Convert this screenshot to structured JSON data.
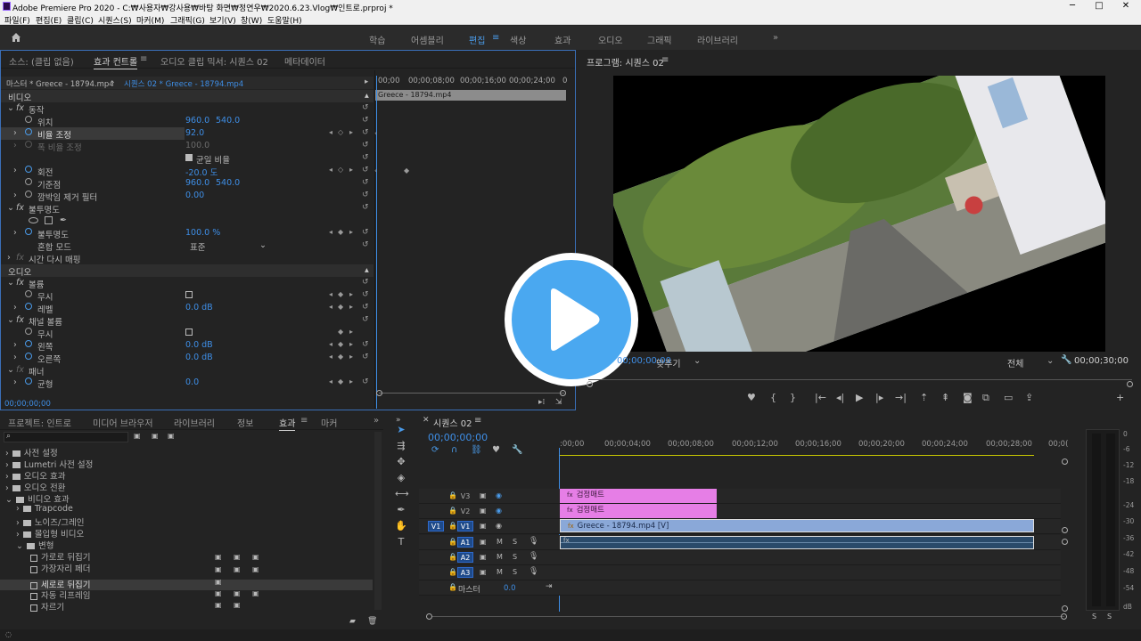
{
  "titlebar": {
    "title": "Adobe Premiere Pro 2020 - C:₩사용자₩강사용₩바탕 화면₩정연우₩2020.6.23.Vlog₩인트로.prproj *",
    "min": "─",
    "max": "□",
    "close": "✕"
  },
  "menu": [
    "파일(F)",
    "편집(E)",
    "클립(C)",
    "시퀀스(S)",
    "마커(M)",
    "그래픽(G)",
    "보기(V)",
    "창(W)",
    "도움말(H)"
  ],
  "workspaces": [
    {
      "label": "학습"
    },
    {
      "label": "어셈블리"
    },
    {
      "label": "편집",
      "active": true
    },
    {
      "label": "색상"
    },
    {
      "label": "효과"
    },
    {
      "label": "오디오"
    },
    {
      "label": "그래픽"
    },
    {
      "label": "라이브러리"
    }
  ],
  "workspaces_more": "»",
  "effect_controls": {
    "tabs": [
      "소스: (클립 없음)",
      "효과 컨트롤",
      "오디오 클립 믹서: 시퀀스 02",
      "메타데이터"
    ],
    "master": "마스터 * Greece - 18794.mp4",
    "sequence": "시퀀스 02 * Greece - 18794.mp4",
    "video_label": "비디오",
    "motion": "동작",
    "position_label": "위치",
    "position_x": "960.0",
    "position_y": "540.0",
    "scale_label": "비율 조정",
    "scale_value": "92.0",
    "scale_width_label": "폭 비율 조정",
    "scale_width_value": "100.0",
    "uniform_label": "균일 비율",
    "rotation_label": "회전",
    "rotation_value": "-20.0 도",
    "anchor_label": "기준점",
    "anchor_x": "960.0",
    "anchor_y": "540.0",
    "flicker_label": "깜박임 제거 필터",
    "flicker_value": "0.00",
    "opacity_section": "불투명도",
    "opacity_label": "불투명도",
    "opacity_value": "100.0 %",
    "blend_label": "혼합 모드",
    "blend_value": "표준",
    "time_remap": "시간 다시 매핑",
    "audio_label": "오디오",
    "volume_section": "볼륨",
    "mute_label": "무시",
    "level_label": "레벨",
    "level_value": "0.0 dB",
    "channel_volume": "채널 볼륨",
    "mute2_label": "무시",
    "left_label": "왼쪽",
    "left_value": "0.0 dB",
    "right_label": "오른쪽",
    "right_value": "0.0 dB",
    "panner": "패너",
    "balance_label": "균형",
    "balance_value": "0.0",
    "timecode": "00;00;00;00",
    "ruler": [
      "00;00",
      "00;00;08;00",
      "00;00;16;00",
      "00;00;24;00",
      "0"
    ],
    "clip_bar": "Greece - 18794.mp4"
  },
  "program": {
    "title": "프로그램: 시퀀스 02",
    "timecode": "00;00;00;00",
    "fit": "맞추기",
    "quality": "전체",
    "duration": "00;00;30;00",
    "play_icon": "play-overlay-icon"
  },
  "project": {
    "tabs": [
      "프로젝트: 인트로",
      "미디어 브라우저",
      "라이브러리",
      "정보",
      "효과",
      "마커"
    ],
    "tree": [
      {
        "label": "사전 설정",
        "indent": 0,
        "type": "folder"
      },
      {
        "label": "Lumetri 사전 설정",
        "indent": 0,
        "type": "folder"
      },
      {
        "label": "오디오 효과",
        "indent": 0,
        "type": "folder"
      },
      {
        "label": "오디오 전환",
        "indent": 0,
        "type": "folder"
      },
      {
        "label": "비디오 효과",
        "indent": 0,
        "type": "folder"
      },
      {
        "label": "Trapcode",
        "indent": 1,
        "type": "folder"
      },
      {
        "label": "노이즈/그레인",
        "indent": 1,
        "type": "folder"
      },
      {
        "label": "몰입형 비디오",
        "indent": 1,
        "type": "folder"
      },
      {
        "label": "변형",
        "indent": 1,
        "type": "folder"
      },
      {
        "label": "가로로 뒤집기",
        "indent": 2,
        "type": "fx"
      },
      {
        "label": "가장자리 페더",
        "indent": 2,
        "type": "fx"
      },
      {
        "label": "세로로 뒤집기",
        "indent": 2,
        "type": "fx",
        "selected": true
      },
      {
        "label": "자동 리프레임",
        "indent": 2,
        "type": "fx"
      },
      {
        "label": "자르기",
        "indent": 2,
        "type": "fx"
      }
    ]
  },
  "timeline": {
    "title": "시퀀스 02",
    "timecode": "00;00;00;00",
    "ruler": [
      ":00;00",
      "00;00;04;00",
      "00;00;08;00",
      "00;00;12;00",
      "00;00;16;00",
      "00;00;20;00",
      "00;00;24;00",
      "00;00;28;00",
      "00;0("
    ],
    "tracks": [
      {
        "name": "V3",
        "clip": "검정매트",
        "src": ""
      },
      {
        "name": "V2",
        "clip": "검정매트",
        "src": ""
      },
      {
        "name": "V1",
        "clip": "Greece - 18794.mp4 [V]",
        "src": "V1"
      },
      {
        "name": "A1",
        "clip": "",
        "src": "A1"
      },
      {
        "name": "A2",
        "clip": "",
        "src": ""
      },
      {
        "name": "A3",
        "clip": "",
        "src": ""
      }
    ],
    "master_label": "마스터",
    "master_value": "0.0"
  },
  "meter": {
    "scale": [
      "0",
      "-6",
      "-12",
      "-18",
      "-24",
      "-30",
      "-36",
      "-42",
      "-48",
      "-54",
      "dB"
    ],
    "solo": [
      "S",
      "S"
    ]
  },
  "colors": {
    "accent": "#3e8ee6",
    "pink": "#e67ee6",
    "v1clip": "#8aa8d8",
    "a1clip": "#2a4a6a",
    "play": "#4aa8f0"
  }
}
